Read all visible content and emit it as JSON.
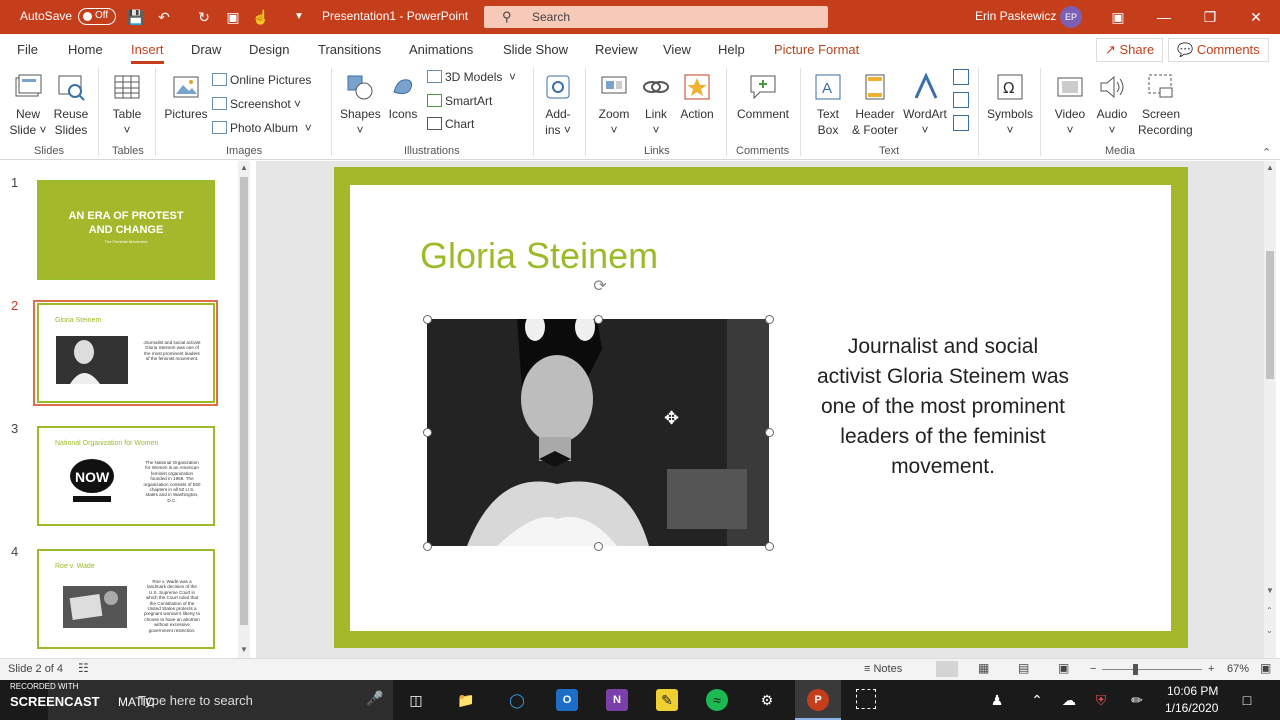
{
  "titlebar": {
    "autosave_label": "AutoSave",
    "autosave_state": "Off",
    "doc_title": "Presentation1 - PowerPoint",
    "search_placeholder": "Search",
    "user_name": "Erin Paskewicz",
    "user_initials": "EP"
  },
  "menu": {
    "tabs": [
      "File",
      "Home",
      "Insert",
      "Draw",
      "Design",
      "Transitions",
      "Animations",
      "Slide Show",
      "Review",
      "View",
      "Help",
      "Picture Format"
    ],
    "active_tab": "Insert",
    "share_label": "Share",
    "comments_label": "Comments"
  },
  "ribbon": {
    "slides": {
      "new_slide": "New",
      "new_slide2": "Slide",
      "reuse": "Reuse",
      "reuse2": "Slides",
      "group": "Slides"
    },
    "tables": {
      "table": "Table",
      "group": "Tables"
    },
    "images": {
      "pictures": "Pictures",
      "online_pictures": "Online Pictures",
      "screenshot": "Screenshot",
      "photo_album": "Photo Album",
      "group": "Images"
    },
    "illustrations": {
      "shapes": "Shapes",
      "icons": "Icons",
      "models": "3D Models",
      "smartart": "SmartArt",
      "chart": "Chart",
      "group": "Illustrations"
    },
    "addins": {
      "label": "Add-",
      "label2": "ins"
    },
    "links": {
      "zoom": "Zoom",
      "link": "Link",
      "action": "Action",
      "group": "Links"
    },
    "comments": {
      "comment": "Comment",
      "group": "Comments"
    },
    "text": {
      "textbox": "Text",
      "textbox2": "Box",
      "header": "Header",
      "header2": "& Footer",
      "wordart": "WordArt",
      "group": "Text"
    },
    "symbols": {
      "label": "Symbols"
    },
    "media": {
      "video": "Video",
      "audio": "Audio",
      "screen": "Screen",
      "screen2": "Recording",
      "group": "Media"
    }
  },
  "thumbnails": [
    {
      "num": "1",
      "title": "AN ERA OF PROTEST AND CHANGE",
      "subtitle": "The Feminist Movement"
    },
    {
      "num": "2",
      "title": "Gloria Steinem",
      "text": "Journalist and social activist Gloria Steinem was one of the most prominent leaders of the feminist movement."
    },
    {
      "num": "3",
      "title": "National Organization for Women",
      "text": "The National Organization for Women is an American feminist organization founded in 1966. The organization consists of 550 chapters in all 50 U.S. states and in Washington, D.C."
    },
    {
      "num": "4",
      "title": "Roe v. Wade",
      "text": "Roe v. Wade was a landmark decision of the U.S. Supreme Court in which the Court ruled that the Constitution of the United States protects a pregnant woman's liberty to choose to have an abortion without excessive government restriction."
    }
  ],
  "slide": {
    "title": "Gloria Steinem",
    "body": "Journalist and social activist Gloria Steinem was one of the most prominent leaders of the feminist movement."
  },
  "status": {
    "slide_indicator": "Slide 2 of 4",
    "notes_label": "Notes",
    "zoom_minus": "−",
    "zoom_plus": "+",
    "zoom_level": "67%"
  },
  "taskbar": {
    "search_text": "Type here to search",
    "watermark1": "RECORDED WITH",
    "watermark2": "SCREENCAST",
    "watermark3": "MATIC",
    "time": "10:06 PM",
    "date": "1/16/2020"
  },
  "colors": {
    "accent": "#c43e1c",
    "slide_green": "#a4b82c",
    "title_green": "#9bbb2a"
  }
}
